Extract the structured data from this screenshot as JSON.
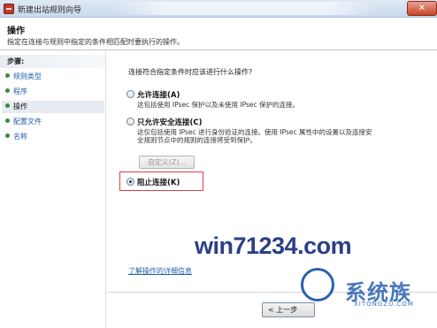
{
  "window": {
    "title": "新建出站规则向导",
    "close_label": "✕"
  },
  "header": {
    "title": "操作",
    "description": "指定在连接与规则中指定的条件相匹配时要执行的操作。"
  },
  "sidebar": {
    "steps_title": "步骤:",
    "items": [
      {
        "label": "规则类型"
      },
      {
        "label": "程序"
      },
      {
        "label": "操作"
      },
      {
        "label": "配置文件"
      },
      {
        "label": "名称"
      }
    ]
  },
  "main": {
    "question": "连接符合指定条件时应该进行什么操作?",
    "options": [
      {
        "label": "允许连接(A)",
        "desc": [
          "这包括使用 IPsec 保护以及未使用 IPsec 保护的连接。"
        ],
        "checked": false
      },
      {
        "label": "只允许安全连接(C)",
        "desc": [
          "这仅包括使用 IPsec 进行身份验证的连接。使用 IPsec 属性中的设置以及连接安",
          "全规则节点中的规则的连接将受到保护。"
        ],
        "checked": false
      },
      {
        "label": "阻止连接(K)",
        "desc": [],
        "checked": true
      }
    ],
    "customize_label": "自定义(Z)...",
    "learn_more": "了解操作的详细信息"
  },
  "footer": {
    "back_label": "< 上一步"
  },
  "watermark": {
    "site": "win71234.com",
    "brand": "系统族",
    "sub": "XITONGZU.COM"
  },
  "colors": {
    "link": "#1f5fa8",
    "highlight": "#d9414a",
    "watermark": "#2a3f86"
  }
}
